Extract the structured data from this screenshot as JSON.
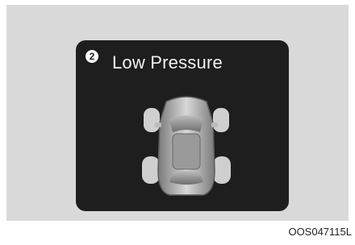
{
  "warning": {
    "badge_number": "2",
    "message": "Low Pressure",
    "icon": "car-top-view-icon"
  },
  "figure_code": "OOS047115L",
  "colors": {
    "panel_background": "#d9d9d9",
    "screen_background": "#1e1e1e",
    "text": "#f2f2f2"
  }
}
